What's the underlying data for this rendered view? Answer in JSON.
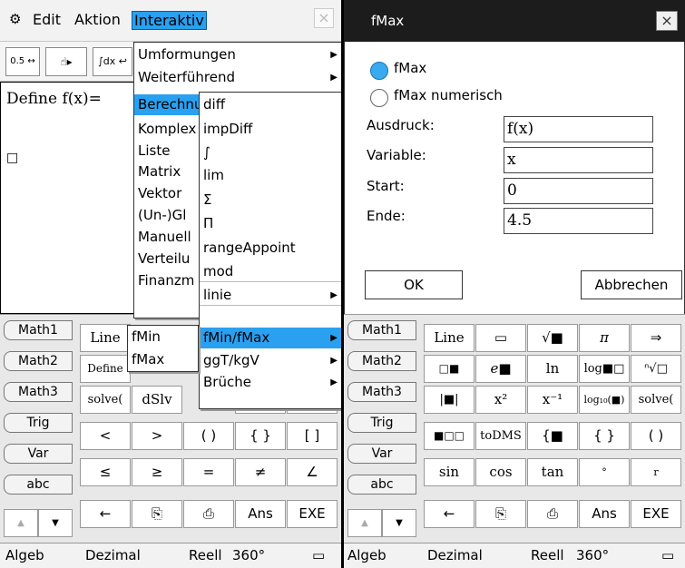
{
  "left": {
    "menubar": {
      "edit": "Edit",
      "aktion": "Aktion",
      "interaktiv": "Interaktiv",
      "close": "×"
    },
    "toolbar": {
      "fraction_btn": "0.5 ↔ ½",
      "hand_btn": "☝▸",
      "int_btn": "∫dx ↩"
    },
    "work": {
      "line1": "Define f(x)=",
      "line2": "□"
    },
    "menu1": [
      {
        "label": "Umformungen",
        "arrow": "▶"
      },
      {
        "label": "Weiterführend",
        "arrow": "▶"
      },
      {
        "label": "Berechnungen"
      },
      {
        "label": "Komplex"
      },
      {
        "label": "Liste"
      },
      {
        "label": "Matrix"
      },
      {
        "label": "Vektor"
      },
      {
        "label": "(Un-)Gl"
      },
      {
        "label": "Manuell"
      },
      {
        "label": "Verteilu"
      },
      {
        "label": "Finanzm"
      }
    ],
    "menu2": [
      {
        "label": "diff"
      },
      {
        "label": "impDiff"
      },
      {
        "label": "∫"
      },
      {
        "label": "lim"
      },
      {
        "label": "Σ"
      },
      {
        "label": "Π"
      },
      {
        "label": "rangeAppoint"
      },
      {
        "label": "mod"
      },
      {
        "label": "linie",
        "arrow": "▶"
      },
      {
        "label": "fMin/fMax",
        "arrow": "▶"
      },
      {
        "label": "ggT/kgV",
        "arrow": "▶"
      },
      {
        "label": "Brüche",
        "arrow": "▶"
      }
    ],
    "menu3": [
      {
        "label": "fMin"
      },
      {
        "label": "fMax"
      }
    ],
    "tabs": [
      "Math1",
      "Math2",
      "Math3",
      "Trig",
      "Var",
      "abc"
    ],
    "keys": {
      "r0": [
        "Line",
        "",
        "",
        "",
        "",
        ""
      ],
      "r1": [
        "Define",
        "",
        "",
        "",
        "",
        ""
      ],
      "r2": [
        "solve(",
        "dSlv",
        "",
        "",
        "[□;□]",
        "|"
      ],
      "r3": [
        "<",
        ">",
        "( )",
        "{ }",
        "[ ]"
      ],
      "r4": [
        "≤",
        "≥",
        "=",
        "≠",
        "∠"
      ],
      "r5": [
        "←",
        "⎘",
        "⎙",
        "Ans",
        "EXE"
      ]
    },
    "scroll": [
      "▲",
      "▼"
    ],
    "status": {
      "mode": "Algeb",
      "number": "Dezimal",
      "domain": "Reell",
      "angle": "360°",
      "battery": "▭"
    }
  },
  "right": {
    "title": "fMax",
    "close": "×",
    "radio1": "fMax",
    "radio2": "fMax numerisch",
    "fields": [
      {
        "label": "Ausdruck:",
        "value": "f(x)"
      },
      {
        "label": "Variable:",
        "value": "x"
      },
      {
        "label": "Start:",
        "value": "0"
      },
      {
        "label": "Ende:",
        "value": "4.5"
      }
    ],
    "ok": "OK",
    "cancel": "Abbrechen",
    "tabs": [
      "Math1",
      "Math2",
      "Math3",
      "Trig",
      "Var",
      "abc"
    ],
    "keys": {
      "r0": [
        "Line",
        "▭",
        "√■",
        "π",
        "⇒"
      ],
      "r1": [
        "□■",
        "e■",
        "ln",
        "log■□",
        "ⁿ√□"
      ],
      "r2": [
        "|■|",
        "x²",
        "x⁻¹",
        "log₁₀(■)",
        "solve("
      ],
      "r3": [
        "■□□",
        "toDMS",
        "{■",
        "{ }",
        "( )"
      ],
      "r4": [
        "sin",
        "cos",
        "tan",
        "°",
        "r"
      ],
      "r5": [
        "←",
        "⎘",
        "⎙",
        "Ans",
        "EXE"
      ]
    },
    "scroll": [
      "▲",
      "▼"
    ],
    "status": {
      "mode": "Algeb",
      "number": "Dezimal",
      "domain": "Reell",
      "angle": "360°",
      "battery": "▭"
    }
  }
}
